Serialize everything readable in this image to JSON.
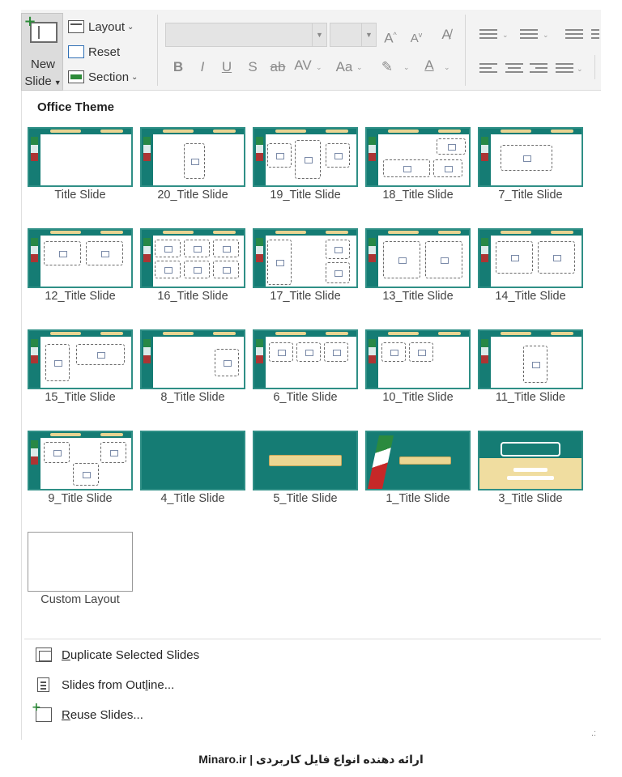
{
  "ribbon": {
    "new_slide_line1": "New",
    "new_slide_line2": "Slide",
    "layout_label": "Layout",
    "reset_label": "Reset",
    "section_label": "Section"
  },
  "gallery": {
    "section_title": "Office Theme",
    "layouts": [
      {
        "label": "Title Slide"
      },
      {
        "label": "20_Title Slide"
      },
      {
        "label": "19_Title Slide"
      },
      {
        "label": "18_Title Slide"
      },
      {
        "label": "7_Title Slide"
      },
      {
        "label": "12_Title Slide"
      },
      {
        "label": "16_Title Slide"
      },
      {
        "label": "17_Title Slide"
      },
      {
        "label": "13_Title Slide"
      },
      {
        "label": "14_Title Slide"
      },
      {
        "label": "15_Title Slide"
      },
      {
        "label": "8_Title Slide"
      },
      {
        "label": "6_Title Slide"
      },
      {
        "label": "10_Title Slide"
      },
      {
        "label": "11_Title Slide"
      },
      {
        "label": "9_Title Slide"
      },
      {
        "label": "4_Title Slide"
      },
      {
        "label": "5_Title Slide"
      },
      {
        "label": "1_Title Slide"
      },
      {
        "label": "3_Title Slide"
      },
      {
        "label": "Custom Layout"
      }
    ]
  },
  "menu": {
    "duplicate_prefix": "",
    "duplicate_accel": "D",
    "duplicate_rest": "uplicate Selected Slides",
    "outline_prefix": "Slides from Out",
    "outline_accel": "l",
    "outline_rest": "ine...",
    "reuse_prefix": "",
    "reuse_accel": "R",
    "reuse_rest": "euse Slides..."
  },
  "watermark": "Minaro.ir | ارائه دهنده انواع فایل کاربردی",
  "colors": {
    "theme_teal": "#157c74",
    "theme_gold": "#e9d491",
    "ribbon_bg": "#f3f3f3"
  }
}
